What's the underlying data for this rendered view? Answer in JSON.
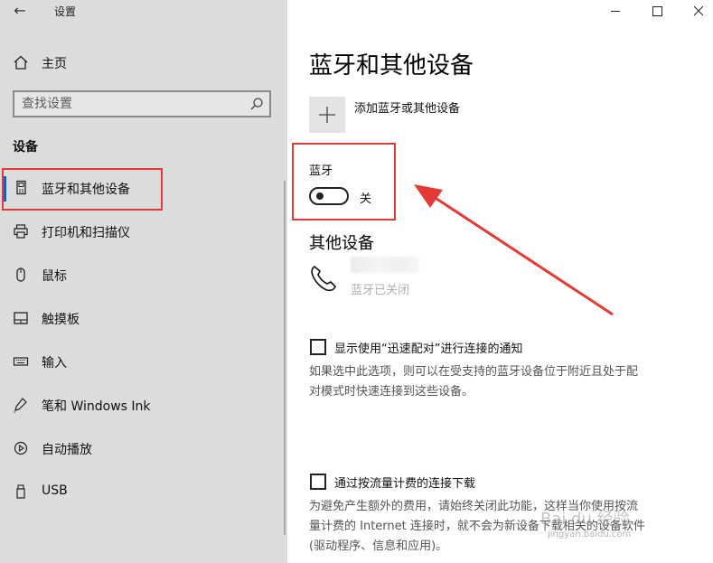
{
  "window": {
    "app_title": "设置",
    "controls": [
      "minimize-icon",
      "maximize-icon",
      "close-icon"
    ]
  },
  "sidebar": {
    "home_label": "主页",
    "search_placeholder": "查找设置",
    "section_header": "设备",
    "items": [
      {
        "label": "蓝牙和其他设备",
        "icon": "bluetooth-devices-icon",
        "selected": true
      },
      {
        "label": "打印机和扫描仪",
        "icon": "printer-icon"
      },
      {
        "label": "鼠标",
        "icon": "mouse-icon"
      },
      {
        "label": "触摸板",
        "icon": "touchpad-icon"
      },
      {
        "label": "输入",
        "icon": "keyboard-icon"
      },
      {
        "label": "笔和 Windows Ink",
        "icon": "pen-icon"
      },
      {
        "label": "自动播放",
        "icon": "autoplay-icon"
      },
      {
        "label": "USB",
        "icon": "usb-icon"
      }
    ]
  },
  "main": {
    "page_title": "蓝牙和其他设备",
    "add_device_label": "添加蓝牙或其他设备",
    "bluetooth_label": "蓝牙",
    "bluetooth_state": "关",
    "other_devices_header": "其他设备",
    "device_status": "蓝牙已关闭",
    "swift_pair": {
      "label": "显示使用“迅速配对”进行连接的通知",
      "checked": false,
      "desc_line1": "如果选中此选项，则可以在受支持的蓝牙设备位于附近且处于配",
      "desc_line2": "对模式时快速连接到这些设备。"
    },
    "metered": {
      "label": "通过按流量计费的连接下载",
      "checked": false,
      "desc_line1": "为避免产生额外的费用，请始终关闭此功能，这样当你使用按流",
      "desc_line2": "量计费的 Internet 连接时，就不会为新设备下载相关的设备软件",
      "desc_line3": "(驱动程序、信息和应用)。"
    }
  },
  "colors": {
    "highlight_red": "#e53935",
    "sidebar_bg": "#dcdcdc",
    "accent": "#1a5fb4"
  },
  "watermark": {
    "main": "Bai du 经验",
    "sub": "jingyan.baidu.com"
  }
}
